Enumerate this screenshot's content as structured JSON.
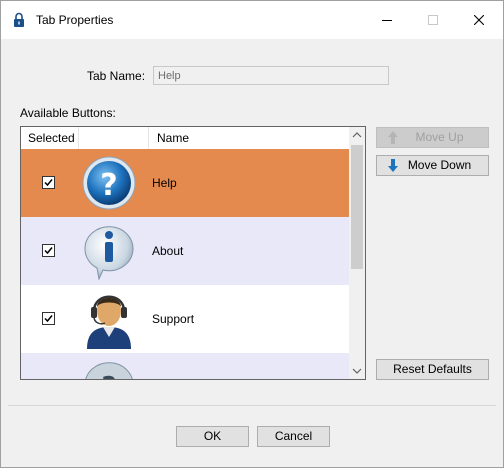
{
  "window": {
    "title": "Tab Properties"
  },
  "form": {
    "tab_name_label": "Tab Name:",
    "tab_name_value": "Help",
    "available_buttons_label": "Available Buttons:"
  },
  "list": {
    "columns": [
      "Selected",
      "",
      "Name"
    ],
    "rows": [
      {
        "name": "Help",
        "icon": "question-mark-icon",
        "checked": true
      },
      {
        "name": "About",
        "icon": "info-bubble-icon",
        "checked": true
      },
      {
        "name": "Support",
        "icon": "support-headset-person-icon",
        "checked": true
      },
      {
        "name": "",
        "icon": "question-mark-bubble-icon",
        "checked": false
      }
    ]
  },
  "buttons": {
    "move_up": "Move Up",
    "move_down": "Move Down",
    "reset_defaults": "Reset Defaults",
    "ok": "OK",
    "cancel": "Cancel"
  },
  "colors": {
    "selected_row": "#e58a4e",
    "alt_row": "#e8e8f8",
    "accent_blue": "#1e73be"
  }
}
